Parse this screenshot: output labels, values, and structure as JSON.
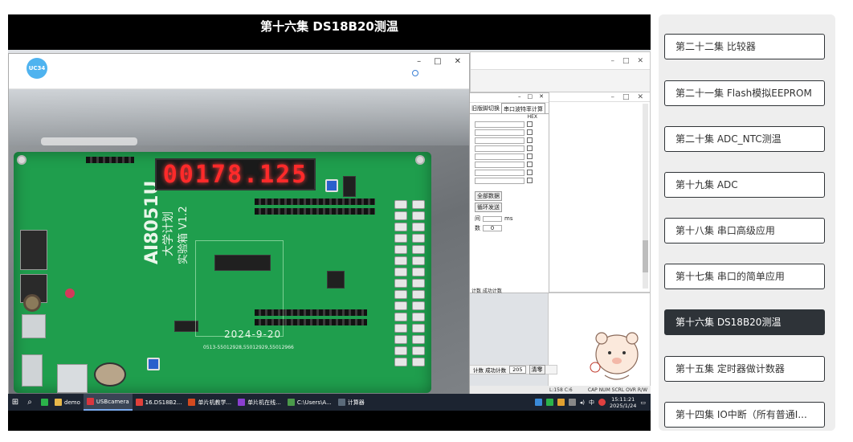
{
  "player": {
    "title": "第十六集 DS18B20测温"
  },
  "camera_app": {
    "logo_text": "UC34",
    "window_controls": [
      "–",
      "□",
      "✕"
    ]
  },
  "board": {
    "display_digits": "00178.125",
    "model_text": "AI8051U",
    "subtitle_text": "大学计划",
    "kit_text": "实验箱 V1.2",
    "date_text": "2024-9-20",
    "phone_text": "0513-55012928,55012929,55012966"
  },
  "serial_tool": {
    "tabs": [
      "旧版脚切换",
      "串口波特率计算"
    ],
    "row_label": "HEX",
    "buttons": [
      "全部数据",
      "循环发送"
    ],
    "labels": [
      "间",
      "ms",
      "数",
      "0"
    ],
    "bottom_text": "计数 成功计数",
    "bottom_count": "205",
    "bottom_button": "清零"
  },
  "statusbar": {
    "position": "L:158 C:6",
    "indicators": "CAP  NUM  SCRL  OVR  R/W"
  },
  "taskbar": {
    "apps": [
      {
        "label": "demo",
        "color": "#e8b84a"
      },
      {
        "label": "USBcamera",
        "color": "#d9363e",
        "active": true
      },
      {
        "label": "16.DS18B2...",
        "color": "#e0403a"
      },
      {
        "label": "单片机教学...",
        "color": "#d34a1f"
      },
      {
        "label": "单片机在线...",
        "color": "#8a3fd0"
      },
      {
        "label": "C:\\Users\\A...",
        "color": "#4a9a4a"
      },
      {
        "label": "计算器",
        "color": "#5a6a7a"
      }
    ],
    "clock_time": "15:11:21",
    "clock_date": "2025/1/24",
    "tray_lang": "中"
  },
  "playlist": {
    "items": [
      {
        "label": "第二十二集 比较器",
        "active": false
      },
      {
        "label": "第二十一集 Flash模拟EEPROM",
        "active": false
      },
      {
        "label": "第二十集 ADC_NTC测温",
        "active": false
      },
      {
        "label": "第十九集 ADC",
        "active": false
      },
      {
        "label": "第十八集 串口高级应用",
        "active": false
      },
      {
        "label": "第十七集 串口的简单应用",
        "active": false
      },
      {
        "label": "第十六集 DS18B20测温",
        "active": true
      },
      {
        "label": "第十五集 定时器做计数器",
        "active": false
      },
      {
        "label": "第十四集 IO中断（所有普通I...",
        "active": false
      }
    ]
  }
}
